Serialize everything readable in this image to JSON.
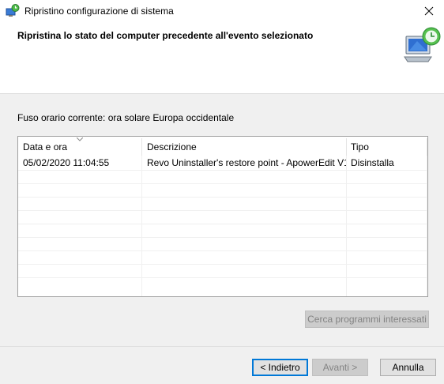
{
  "window": {
    "title": "Ripristino configurazione di sistema"
  },
  "header": {
    "title": "Ripristina lo stato del computer precedente all'evento selezionato"
  },
  "timezone": {
    "label": "Fuso orario corrente: ora solare Europa occidentale"
  },
  "table": {
    "columns": [
      "Data e ora",
      "Descrizione",
      "Tipo"
    ],
    "rows": [
      {
        "date": "05/02/2020 11:04:55",
        "description": "Revo Uninstaller's restore point - ApowerEdit V1....",
        "type": "Disinstalla"
      }
    ]
  },
  "buttons": {
    "scan": "Cerca programmi interessati",
    "back": "< Indietro",
    "next": "Avanti >",
    "cancel": "Annulla"
  },
  "icons": {
    "app": "system-restore-icon",
    "header": "system-restore-computer-icon",
    "close": "close-icon"
  },
  "colors": {
    "accent": "#0078d7",
    "header_bg": "#ffffff",
    "body_bg": "#f0f0f0"
  }
}
